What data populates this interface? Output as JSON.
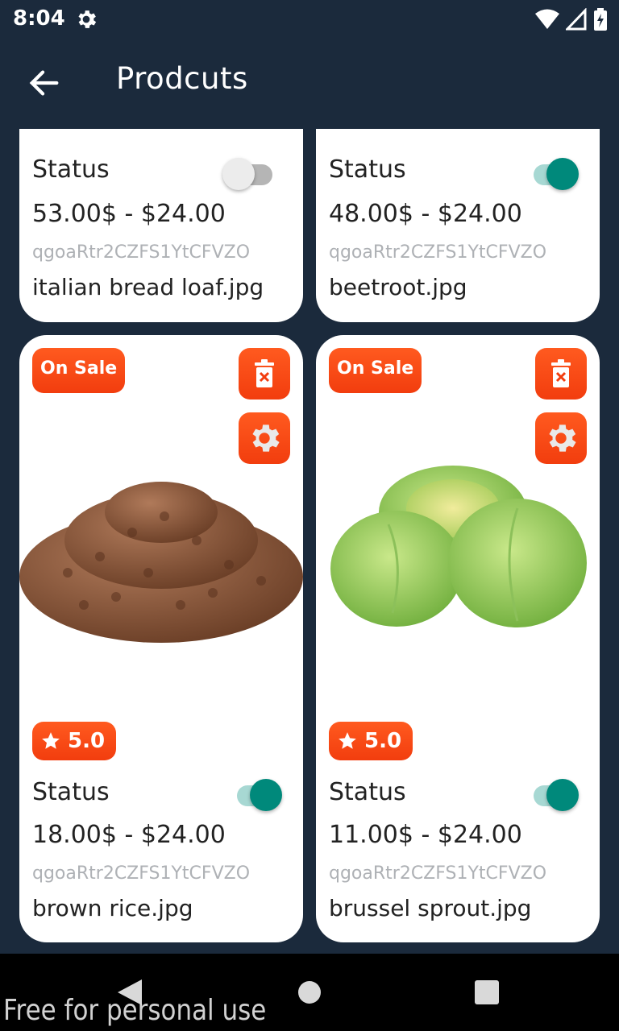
{
  "status_bar": {
    "time": "8:04"
  },
  "app_bar": {
    "title": "Prodcuts"
  },
  "cards": [
    {
      "status_label": "Status",
      "price": "53.00$ - $24.00",
      "uid": "qgoaRtr2CZFS1YtCFVZO",
      "filename": "italian bread loaf.jpg",
      "toggle": "off"
    },
    {
      "status_label": "Status",
      "price": "48.00$ - $24.00",
      "uid": "qgoaRtr2CZFS1YtCFVZO",
      "filename": "beetroot.jpg",
      "toggle": "on"
    },
    {
      "badge": "On Sale",
      "rating": "5.0",
      "status_label": "Status",
      "price": "18.00$ - $24.00",
      "uid": "qgoaRtr2CZFS1YtCFVZO",
      "filename": "brown rice.jpg",
      "toggle": "on"
    },
    {
      "badge": "On Sale",
      "rating": "5.0",
      "status_label": "Status",
      "price": "11.00$ - $24.00",
      "uid": "qgoaRtr2CZFS1YtCFVZO",
      "filename": "brussel sprout.jpg",
      "toggle": "on"
    }
  ],
  "watermark": "Free for personal use",
  "colors": {
    "background": "#1b2a3c",
    "accent": "#f23d0e",
    "toggle_on": "#00897b"
  }
}
